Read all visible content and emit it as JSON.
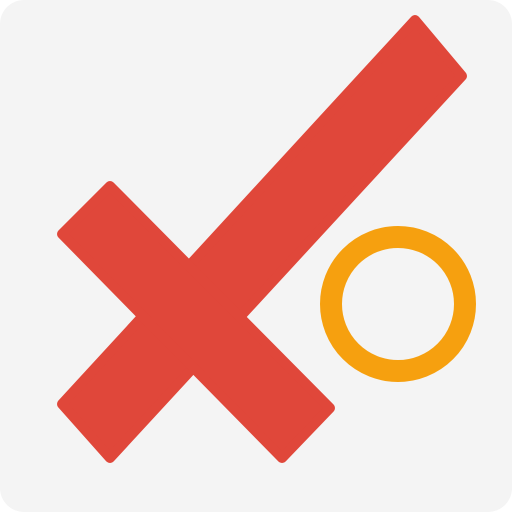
{
  "icon": {
    "name": "tic-tac-toe-xo-logo",
    "colors": {
      "background": "#f4f4f4",
      "x_mark": "#e0473a",
      "o_mark": "#f6a00f"
    }
  }
}
